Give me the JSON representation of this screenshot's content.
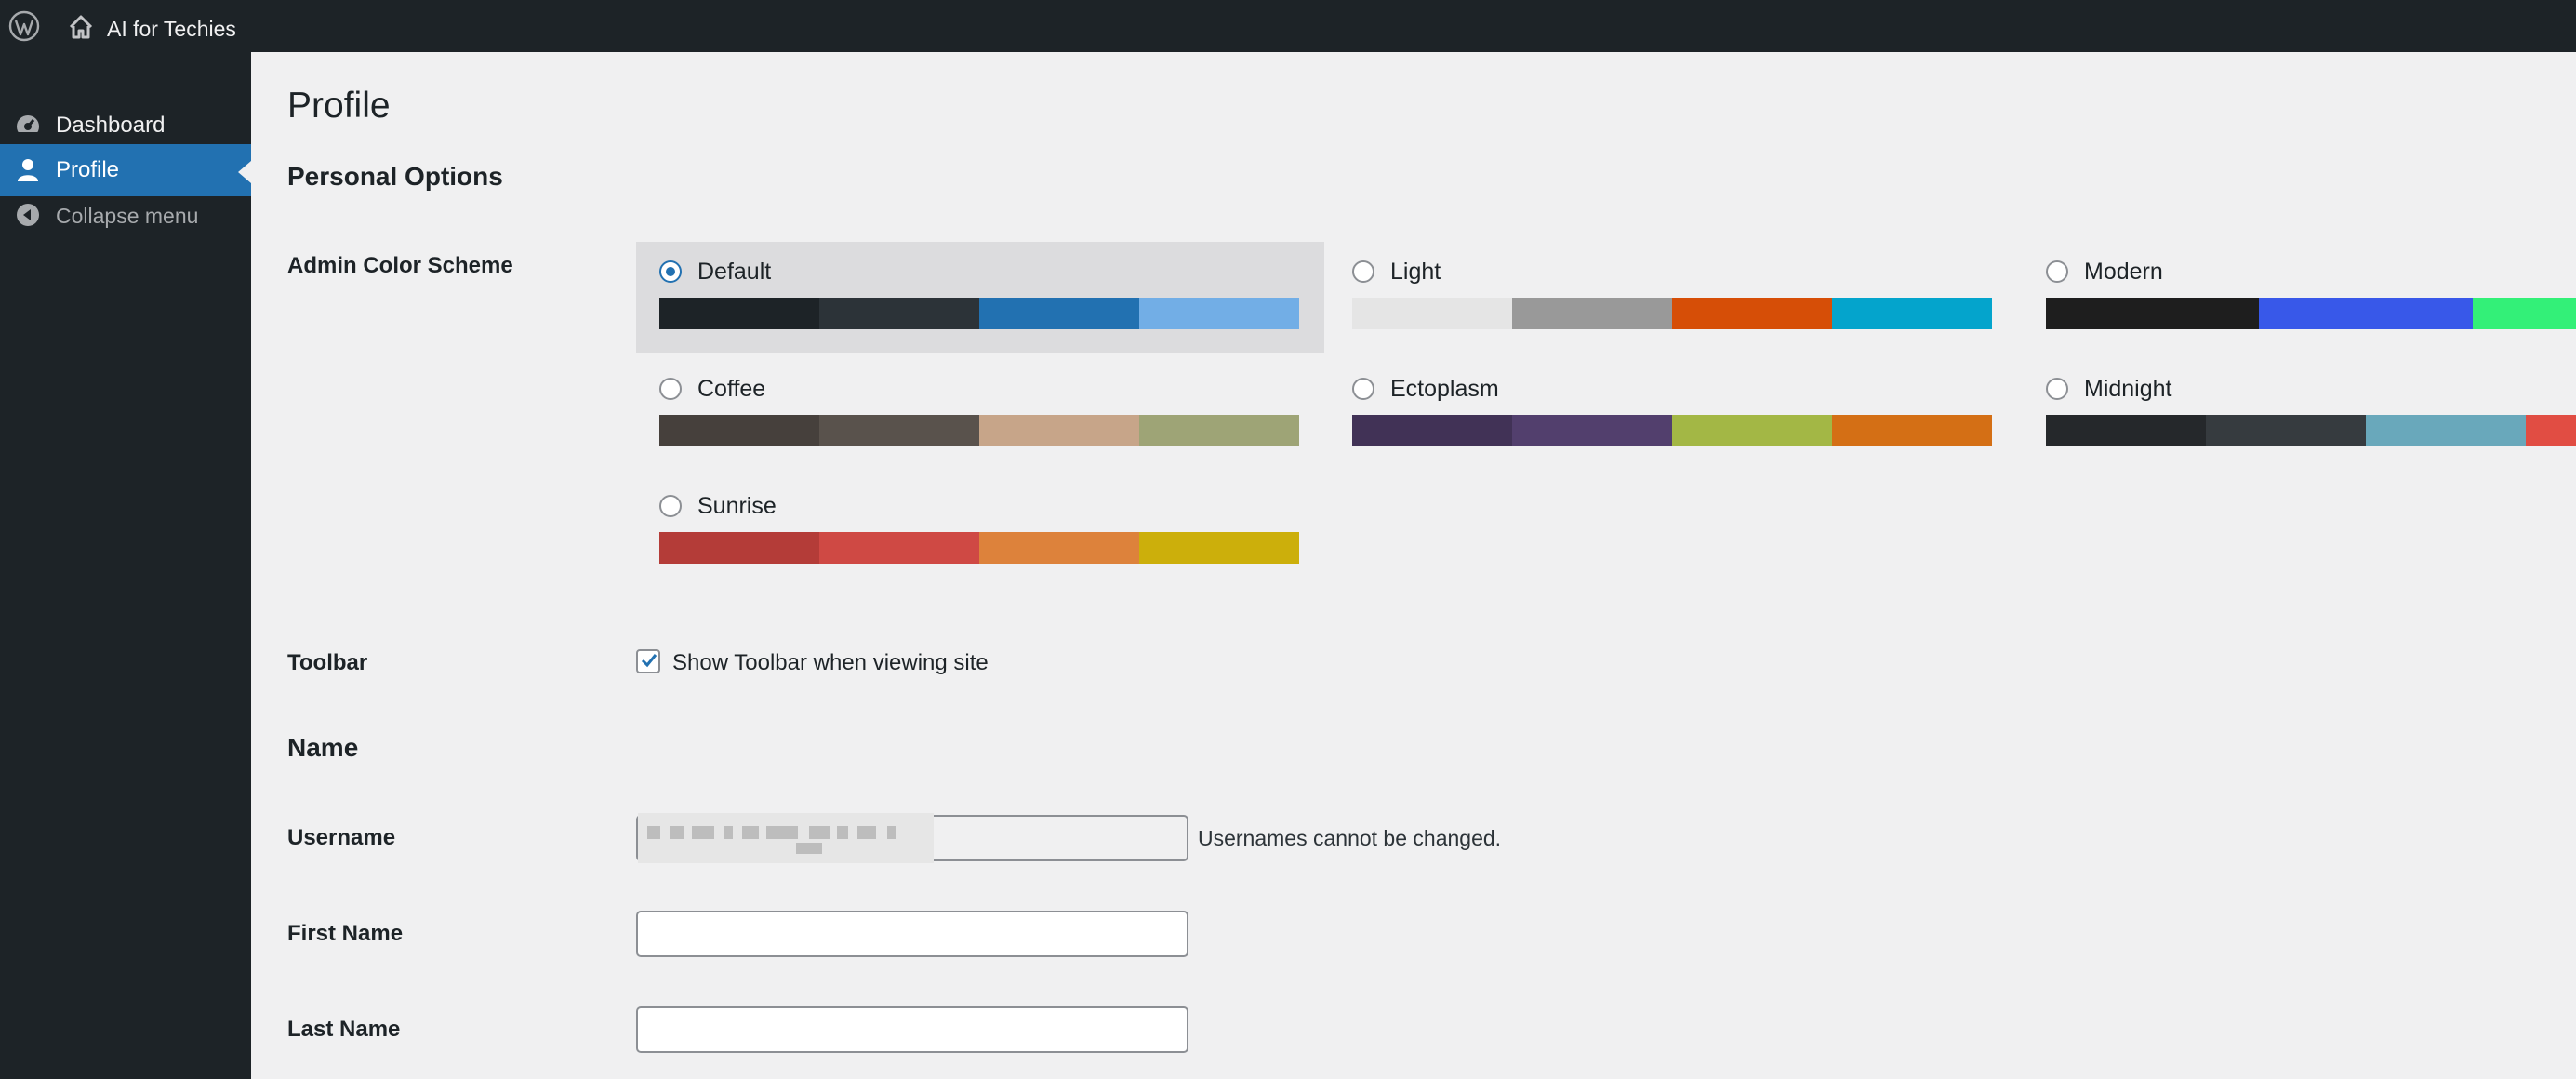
{
  "admin_bar": {
    "logo_icon": "wordpress-logo-icon",
    "home_icon": "home-icon",
    "site_name": "AI for Techies"
  },
  "sidebar": {
    "items": [
      {
        "label": "Dashboard",
        "icon": "dashboard-icon",
        "active": false
      },
      {
        "label": "Profile",
        "icon": "user-icon",
        "active": true
      },
      {
        "label": "Collapse menu",
        "icon": "collapse-arrow-icon",
        "active": false
      }
    ]
  },
  "page": {
    "title": "Profile",
    "personal_options_heading": "Personal Options",
    "admin_color_scheme_label": "Admin Color Scheme",
    "color_schemes": [
      {
        "name": "Default",
        "selected": true,
        "colors": [
          "#1d2327",
          "#2c3338",
          "#2271b1",
          "#72aee6"
        ]
      },
      {
        "name": "Light",
        "selected": false,
        "colors": [
          "#e5e5e5",
          "#999999",
          "#d64e07",
          "#04a4cc"
        ]
      },
      {
        "name": "Modern",
        "selected": false,
        "colors": [
          "#1e1e1e",
          "#3858e9",
          "#33f078"
        ]
      },
      {
        "name": "Coffee",
        "selected": false,
        "colors": [
          "#46403c",
          "#59524c",
          "#c7a589",
          "#9ea476"
        ]
      },
      {
        "name": "Ectoplasm",
        "selected": false,
        "colors": [
          "#413256",
          "#523f6d",
          "#a3b745",
          "#d46f15"
        ]
      },
      {
        "name": "Midnight",
        "selected": false,
        "colors": [
          "#25282b",
          "#363b3f",
          "#69a8bb",
          "#e14d43"
        ]
      },
      {
        "name": "Sunrise",
        "selected": false,
        "colors": [
          "#b43c38",
          "#cf4944",
          "#dd823b",
          "#ccaf0b"
        ]
      }
    ],
    "toolbar_label": "Toolbar",
    "toolbar_checkbox_label": "Show Toolbar when viewing site",
    "toolbar_checked": true,
    "name_heading": "Name",
    "username_label": "Username",
    "username_note": "Usernames cannot be changed.",
    "first_name_label": "First Name",
    "first_name_value": "",
    "last_name_label": "Last Name",
    "last_name_value": "",
    "accent_color": "#2271b1"
  }
}
